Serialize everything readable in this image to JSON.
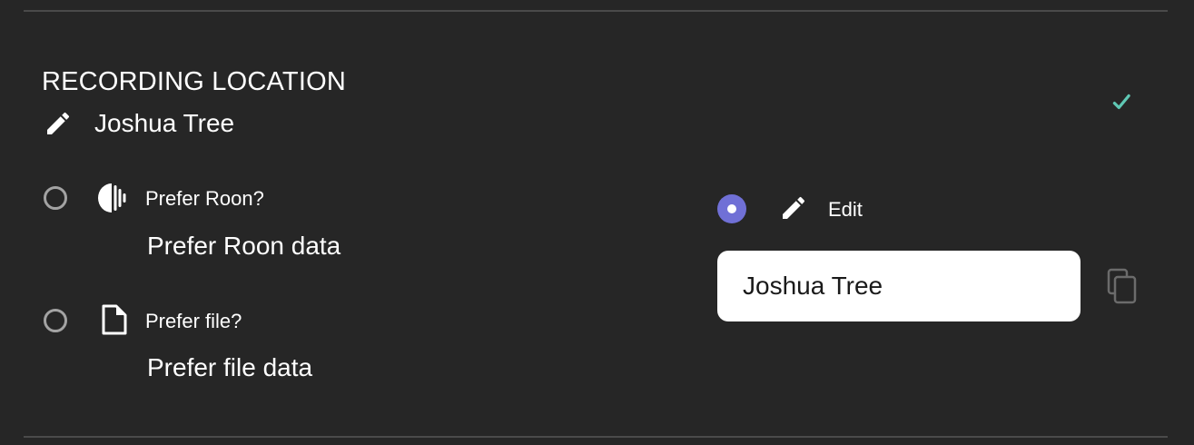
{
  "section": {
    "title": "RECORDING LOCATION",
    "current_value": "Joshua Tree"
  },
  "options": {
    "roon": {
      "label": "Prefer Roon?",
      "value": "Prefer Roon data",
      "selected": false,
      "icon": "roon-icon"
    },
    "file": {
      "label": "Prefer file?",
      "value": "Prefer file data",
      "selected": false,
      "icon": "file-icon"
    },
    "edit": {
      "label": "Edit",
      "value": "Joshua Tree",
      "selected": true,
      "icon": "pencil-icon"
    }
  },
  "colors": {
    "background": "#262626",
    "accent": "#7070d6",
    "check": "#5fc8b4",
    "muted": "#a3a3a3"
  }
}
